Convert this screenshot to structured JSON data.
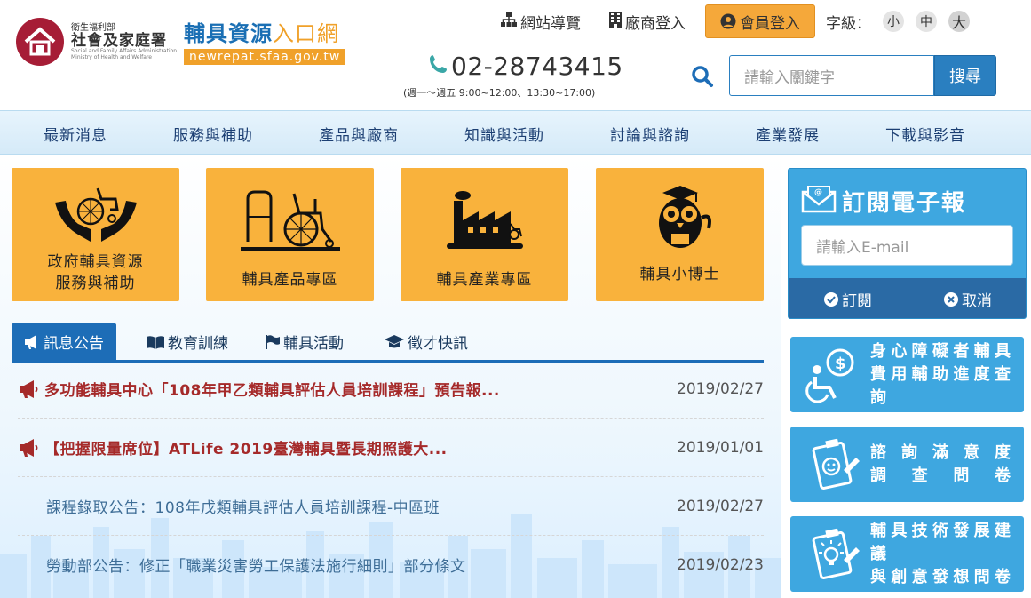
{
  "header": {
    "logo_org_line1": "衛生福利部",
    "logo_org_line2": "社會及家庭署",
    "logo_org_en": "Social and Family Affairs Administration Ministry of Health and Welfare",
    "site_title_a": "輔具資源",
    "site_title_b": "入口網",
    "site_domain": "newrepat.sfaa.gov.tw",
    "links": {
      "sitemap": "網站導覽",
      "vendor_login": "廠商登入",
      "member_login": "會員登入"
    },
    "font_size_label": "字級：",
    "font_sizes": [
      "小",
      "中",
      "大"
    ],
    "phone": "02-28743415",
    "hours": "(週一～週五 9:00~12:00、13:30~17:00)",
    "search_placeholder": "請輸入關鍵字",
    "search_button": "搜尋"
  },
  "nav": [
    "最新消息",
    "服務與補助",
    "產品與廠商",
    "知識與活動",
    "討論與諮詢",
    "產業發展",
    "下載與影音"
  ],
  "tiles": [
    {
      "line1": "政府輔具資源",
      "line2": "服務與補助",
      "icon": "hands-wheelchair-icon"
    },
    {
      "line1": "輔具產品專區",
      "line2": "",
      "icon": "walker-wheelchair-icon"
    },
    {
      "line1": "輔具產業專區",
      "line2": "",
      "icon": "factory-icon"
    },
    {
      "line1": "輔具小博士",
      "line2": "",
      "icon": "owl-doctor-icon"
    }
  ],
  "tabs": [
    "訊息公告",
    "教育訓練",
    "輔具活動",
    "徵才快訊"
  ],
  "news": [
    {
      "title": "多功能輔具中心「108年甲乙類輔具評估人員培訓課程」預告報...",
      "date": "2019/02/27",
      "hot": true
    },
    {
      "title": "【把握限量席位】ATLife 2019臺灣輔具暨長期照護大...",
      "date": "2019/01/01",
      "hot": true
    },
    {
      "title": "課程錄取公告：108年戊類輔具評估人員培訓課程-中區班",
      "date": "2019/02/27",
      "hot": false
    },
    {
      "title": "勞動部公告：修正「職業災害勞工保護法施行細則」部分條文",
      "date": "2019/02/23",
      "hot": false
    }
  ],
  "subscribe": {
    "title": "訂閱電子報",
    "placeholder": "請輸入E-mail",
    "subscribe_btn": "訂閱",
    "cancel_btn": "取消"
  },
  "side_buttons": [
    {
      "line1": "身心障礙者輔具",
      "line2": "費用輔助進度查詢",
      "icon": "wheelchair-money-icon"
    },
    {
      "line1": "諮詢滿意度",
      "line2": "調查問卷",
      "icon": "survey-smile-icon"
    },
    {
      "line1": "輔具技術發展建議",
      "line2": "與創意發想問卷",
      "icon": "survey-idea-icon"
    }
  ],
  "colors": {
    "brand_blue": "#1d6db7",
    "tile_orange": "#f9b23c",
    "sidebar_blue": "#3ea7e0",
    "hot_news_red": "#a52a2a"
  }
}
